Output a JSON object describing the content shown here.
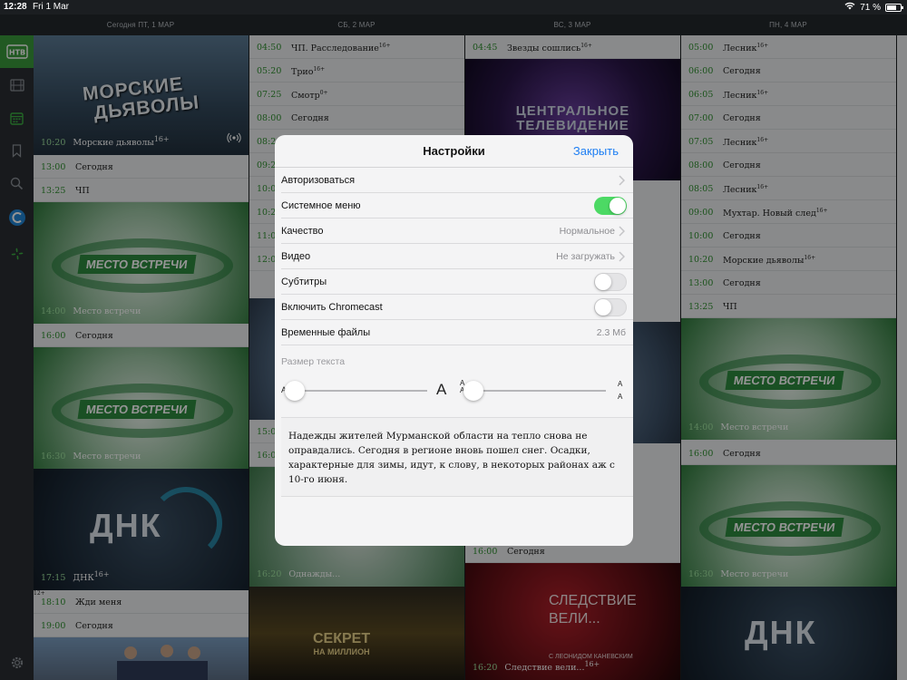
{
  "status": {
    "time": "12:28",
    "date": "Fri 1 Mar",
    "battery": "71 %",
    "battery_level": 0.71
  },
  "days": [
    "Сегодня ПТ, 1 МАР",
    "СБ, 2 МАР",
    "ВС, 3 МАР",
    "ПН, 4 МАР"
  ],
  "sidebar": {
    "logo": "НТВ",
    "icons": [
      "film-icon",
      "calendar-icon",
      "bookmark-icon",
      "search-icon",
      "c-logo-icon",
      "leaf-logo-icon",
      "gear-icon"
    ]
  },
  "col1": {
    "tile_morskie": {
      "logo_line1": "МОРСКИЕ",
      "logo_line2": "ДЬЯВОЛЫ",
      "time": "10:20",
      "name": "Морские дьяволы",
      "age": "16+"
    },
    "rows_a": [
      {
        "time": "13:00",
        "name": "Сегодня"
      },
      {
        "time": "13:25",
        "name": "ЧП"
      }
    ],
    "tile_mesto1": {
      "logo": "МЕСТО ВСТРЕЧИ",
      "time": "14:00",
      "name": "Место встречи"
    },
    "row_b": {
      "time": "16:00",
      "name": "Сегодня"
    },
    "tile_mesto2": {
      "logo": "МЕСТО ВСТРЕЧИ",
      "time": "16:30",
      "name": "Место встречи"
    },
    "tile_dnk": {
      "logo": "ДНК",
      "time": "17:15",
      "name": "ДНК",
      "age": "16+"
    },
    "rows_c": [
      {
        "time": "18:10",
        "name": "Жди меня",
        "age": "12+"
      },
      {
        "time": "19:00",
        "name": "Сегодня"
      }
    ]
  },
  "col2": {
    "rows": [
      {
        "time": "04:50",
        "name": "ЧП. Расследование",
        "age": "16+"
      },
      {
        "time": "05:20",
        "name": "Трио",
        "age": "16+"
      },
      {
        "time": "07:25",
        "name": "Смотр",
        "age": "0+"
      },
      {
        "time": "08:00",
        "name": "Сегодня"
      },
      {
        "time": "08:20",
        "name": ""
      },
      {
        "time": "09:25",
        "name": ""
      },
      {
        "time": "10:00",
        "name": ""
      },
      {
        "time": "10:20",
        "name": ""
      },
      {
        "time": "11:00",
        "name": ""
      },
      {
        "time": "12:00",
        "name": ""
      }
    ],
    "rows_b": [
      {
        "time": "15:00",
        "name": ""
      },
      {
        "time": "16:00",
        "name": ""
      }
    ],
    "tile_b": {
      "time": "16:20",
      "name": "Однажды..."
    },
    "tile_sekret": {
      "logo_line1": "СЕКРЕТ",
      "logo_line2": "НА МИЛЛИОН"
    }
  },
  "col3": {
    "row_top": {
      "time": "04:45",
      "name": "Звезды сошлись",
      "age": "16+"
    },
    "tile_ct": {
      "logo_line1": "ЦЕНТРАЛЬНОЕ",
      "logo_line2": "ТЕЛЕВИДЕНИЕ"
    },
    "row_b": {
      "time": "16:00",
      "name": "Сегодня"
    },
    "tile_sled": {
      "logo_line1": "СЛЕДСТВИЕ",
      "logo_line2": "ВЕЛИ...",
      "sub": "С ЛЕОНИДОМ КАНЕВСКИМ",
      "time": "16:20",
      "name": "Следствие вели...",
      "age": "16+"
    }
  },
  "col4": {
    "rows": [
      {
        "time": "05:00",
        "name": "Лесник",
        "age": "16+"
      },
      {
        "time": "06:00",
        "name": "Сегодня"
      },
      {
        "time": "06:05",
        "name": "Лесник",
        "age": "16+"
      },
      {
        "time": "07:00",
        "name": "Сегодня"
      },
      {
        "time": "07:05",
        "name": "Лесник",
        "age": "16+"
      },
      {
        "time": "08:00",
        "name": "Сегодня"
      },
      {
        "time": "08:05",
        "name": "Лесник",
        "age": "16+"
      },
      {
        "time": "09:00",
        "name": "Мухтар. Новый след",
        "age": "16+"
      },
      {
        "time": "10:00",
        "name": "Сегодня"
      },
      {
        "time": "10:20",
        "name": "Морские дьяволы",
        "age": "16+"
      },
      {
        "time": "13:00",
        "name": "Сегодня"
      },
      {
        "time": "13:25",
        "name": "ЧП"
      }
    ],
    "tile_mesto1": {
      "logo": "МЕСТО ВСТРЕЧИ",
      "time": "14:00",
      "name": "Место встречи"
    },
    "row_b": {
      "time": "16:00",
      "name": "Сегодня"
    },
    "tile_mesto2": {
      "logo": "МЕСТО ВСТРЕЧИ",
      "time": "16:30",
      "name": "Место встречи"
    },
    "tile_dnk": {
      "logo": "ДНК"
    }
  },
  "settings": {
    "title": "Настройки",
    "close": "Закрыть",
    "authorize": "Авторизоваться",
    "system_menu": {
      "label": "Системное меню",
      "on": true
    },
    "quality": {
      "label": "Качество",
      "value": "Нормальное"
    },
    "video": {
      "label": "Видео",
      "value": "Не загружать"
    },
    "subtitles": {
      "label": "Субтитры",
      "on": false
    },
    "chromecast": {
      "label": "Включить Chromecast",
      "on": false
    },
    "temp_files": {
      "label": "Временные файлы",
      "value": "2.3 Мб"
    },
    "text_size": {
      "label": "Размер текста",
      "small_a": "A",
      "big_a": "A",
      "spacing_a1": "A",
      "spacing_a2": "A",
      "spacing_b1": "A",
      "spacing_b2": "A",
      "size_level": 0.0,
      "spacing_level": 0.0
    },
    "preview_text": "Надежды жителей Мурманской области на тепло снова не оправдались. Сегодня в регионе вновь пошел снег. Осадки, характерные для зимы, идут, к слову, в некоторых районах аж с 10-го июня."
  }
}
